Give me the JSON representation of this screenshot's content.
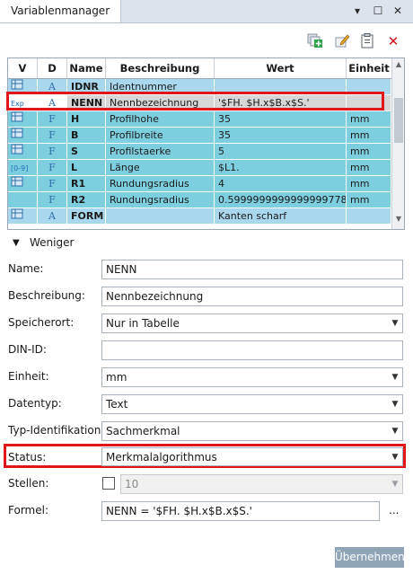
{
  "window": {
    "title": "Variablenmanager",
    "controls": [
      "▾",
      "☐",
      "✕"
    ]
  },
  "toolbar": {
    "icons": [
      "add-variable-icon",
      "edit-variable-icon",
      "clipboard-icon",
      "delete-icon"
    ],
    "delete_glyph": "✕"
  },
  "colors": {
    "row_blue": "#a9d8ee",
    "row_cyan": "#7dcfdf",
    "row_selected": "#d7d7d7",
    "highlight_red": "#e0161b",
    "apply_button": "#8fa5b7"
  },
  "grid": {
    "headers": [
      "V",
      "D",
      "Name",
      "Beschreibung",
      "Wert",
      "Einheit"
    ],
    "rows": [
      {
        "v_icon": "grid-icon",
        "d_icon": "A",
        "name": "IDNR",
        "desc": "Identnummer",
        "wert": "",
        "einheit": ""
      },
      {
        "v_icon": "exp-icon",
        "v_text": "Exp",
        "d_icon": "A",
        "name": "NENN",
        "desc": "Nennbezeichnung",
        "wert": "'$FH. $H.x$B.x$S.'",
        "einheit": ""
      },
      {
        "v_icon": "grid-icon",
        "d_icon": "F",
        "name": "H",
        "desc": "Profilhohe",
        "wert": "35",
        "einheit": "mm"
      },
      {
        "v_icon": "grid-icon",
        "d_icon": "F",
        "name": "B",
        "desc": "Profilbreite",
        "wert": "35",
        "einheit": "mm"
      },
      {
        "v_icon": "grid-icon",
        "d_icon": "F",
        "name": "S",
        "desc": "Profilstaerke",
        "wert": "5",
        "einheit": "mm"
      },
      {
        "v_icon": "range-icon",
        "v_text": "[0-9]",
        "d_icon": "F",
        "name": "L",
        "desc": "Länge",
        "wert": "$L1.",
        "einheit": "mm"
      },
      {
        "v_icon": "grid-icon",
        "d_icon": "F",
        "name": "R1",
        "desc": "Rundungsradius",
        "wert": "4",
        "einheit": "mm"
      },
      {
        "v_icon": "",
        "d_icon": "F",
        "name": "R2",
        "desc": "Rundungsradius",
        "wert": "0.5999999999999999778",
        "einheit": "mm"
      },
      {
        "v_icon": "grid-icon",
        "d_icon": "A",
        "name": "FORM",
        "desc": "",
        "wert": "Kanten scharf",
        "einheit": ""
      }
    ]
  },
  "toggle": {
    "label": "Weniger"
  },
  "form": {
    "name": {
      "label": "Name:",
      "value": "NENN"
    },
    "beschreibung": {
      "label": "Beschreibung:",
      "value": "Nennbezeichnung"
    },
    "speicherort": {
      "label": "Speicherort:",
      "value": "Nur in Tabelle"
    },
    "din_id": {
      "label": "DIN-ID:",
      "value": ""
    },
    "einheit": {
      "label": "Einheit:",
      "value": "mm"
    },
    "datentyp": {
      "label": "Datentyp:",
      "value": "Text"
    },
    "typ_identifikation": {
      "label": "Typ-Identifikation:",
      "value": "Sachmerkmal"
    },
    "status": {
      "label": "Status:",
      "value": "Merkmalalgorithmus"
    },
    "stellen": {
      "label": "Stellen:",
      "value": "10",
      "checked": false
    },
    "formel": {
      "label": "Formel:",
      "value": "NENN = '$FH. $H.x$B.x$S.'",
      "more": "..."
    }
  },
  "apply_button": {
    "label": "Übernehmen"
  }
}
